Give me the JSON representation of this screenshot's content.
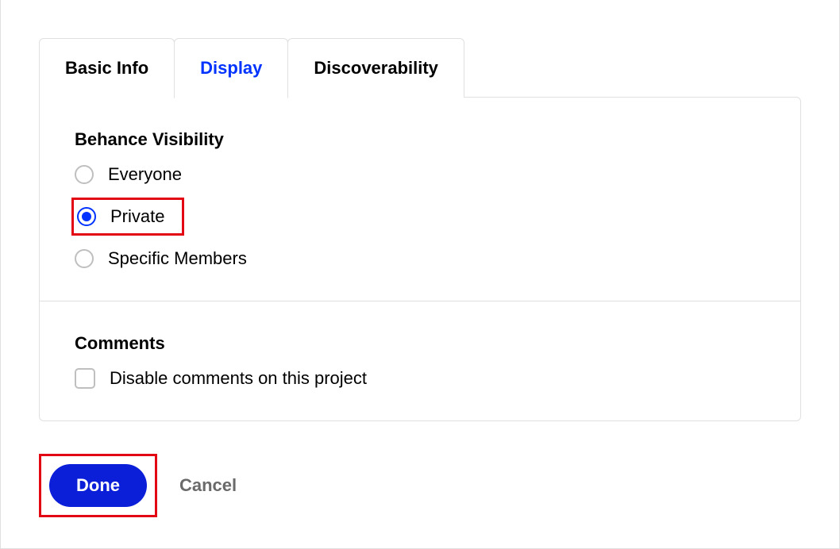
{
  "tabs": {
    "basic_info": "Basic Info",
    "display": "Display",
    "discoverability": "Discoverability",
    "active": "display"
  },
  "visibility": {
    "title": "Behance Visibility",
    "options": {
      "everyone": "Everyone",
      "private": "Private",
      "specific": "Specific Members"
    },
    "selected": "private"
  },
  "comments": {
    "title": "Comments",
    "disable_label": "Disable comments on this project",
    "disabled": false
  },
  "footer": {
    "done": "Done",
    "cancel": "Cancel"
  }
}
